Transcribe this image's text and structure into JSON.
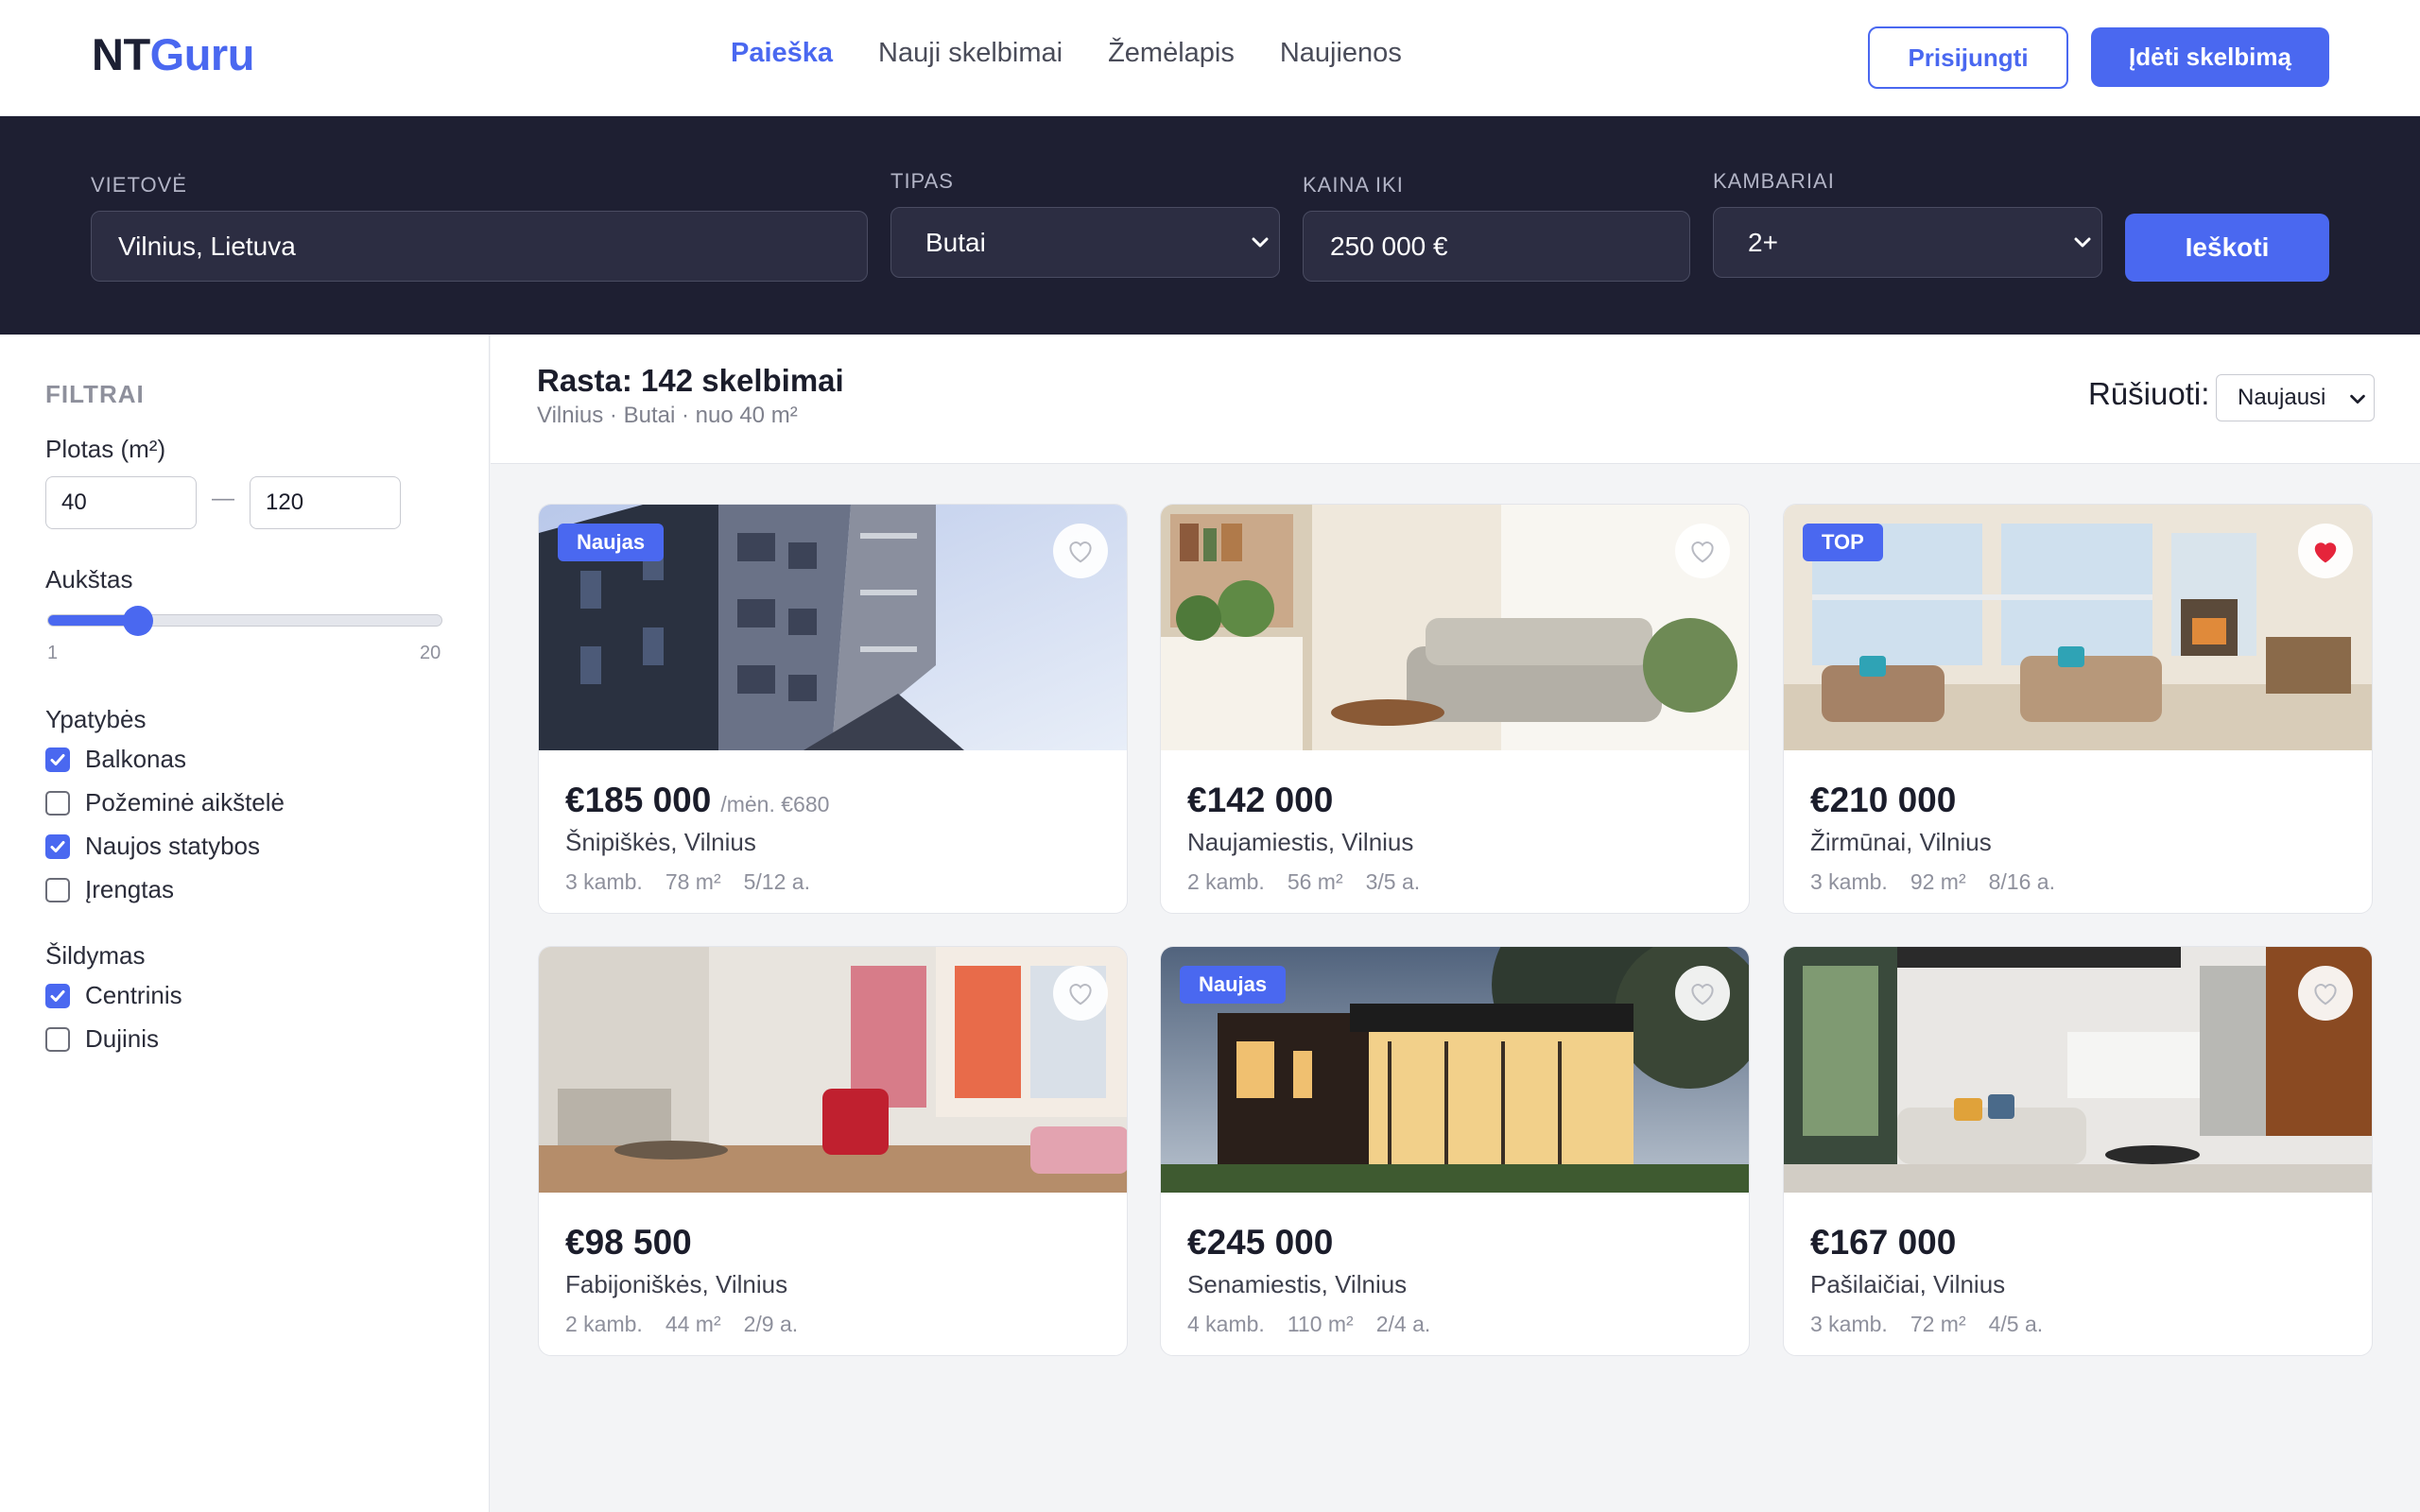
{
  "header": {
    "logo_a": "NT",
    "logo_b": "Guru",
    "nav": [
      "Paieška",
      "Nauji skelbimai",
      "Žemėlapis",
      "Naujienos"
    ],
    "login_label": "Prisijungti",
    "add_label": "Įdėti skelbimą"
  },
  "search": {
    "location_label": "VIETOVĖ",
    "location_value": "Vilnius, Lietuva",
    "type_label": "TIPAS",
    "type_value": "Butai",
    "price_label": "KAINA IKI",
    "price_value": "250 000 €",
    "rooms_label": "KAMBARIAI",
    "rooms_value": "2+",
    "search_label": "Ieškoti"
  },
  "filters": {
    "title": "FILTRAI",
    "area_label": "Plotas (m²)",
    "area_min": "40",
    "area_sep": "—",
    "area_max": "120",
    "floor_label": "Aukštas",
    "floor_min": "1",
    "floor_max": "20",
    "floor_value_fraction": 0.23,
    "features_label": "Ypatybės",
    "features": [
      {
        "label": "Balkonas",
        "checked": true
      },
      {
        "label": "Požeminė aikštelė",
        "checked": false
      },
      {
        "label": "Naujos statybos",
        "checked": true
      },
      {
        "label": "Įrengtas",
        "checked": false
      }
    ],
    "heating_label": "Šildymas",
    "heating": [
      {
        "label": "Centrinis",
        "checked": true
      },
      {
        "label": "Dujinis",
        "checked": false
      }
    ]
  },
  "results": {
    "title": "Rasta: 142 skelbimai",
    "subtitle": "Vilnius · Butai · nuo 40 m²",
    "sort_label": "Rūšiuoti:",
    "sort_value": "Naujausi"
  },
  "listings": [
    {
      "price": "€185 000",
      "extra": "/mėn. €680",
      "location": "Šnipiškės, Vilnius",
      "rooms": "3 kamb.",
      "area": "78 m²",
      "floor": "5/12 a.",
      "badge": "Naujas",
      "favorite": false
    },
    {
      "price": "€142 000",
      "extra": "",
      "location": "Naujamiestis, Vilnius",
      "rooms": "2 kamb.",
      "area": "56 m²",
      "floor": "3/5 a.",
      "badge": "",
      "favorite": false
    },
    {
      "price": "€210 000",
      "extra": "",
      "location": "Žirmūnai, Vilnius",
      "rooms": "3 kamb.",
      "area": "92 m²",
      "floor": "8/16 a.",
      "badge": "TOP",
      "favorite": true
    },
    {
      "price": "€98 500",
      "extra": "",
      "location": "Fabijoniškės, Vilnius",
      "rooms": "2 kamb.",
      "area": "44 m²",
      "floor": "2/9 a.",
      "badge": "",
      "favorite": false
    },
    {
      "price": "€245 000",
      "extra": "",
      "location": "Senamiestis, Vilnius",
      "rooms": "4 kamb.",
      "area": "110 m²",
      "floor": "2/4 a.",
      "badge": "Naujas",
      "favorite": false
    },
    {
      "price": "€167 000",
      "extra": "",
      "location": "Pašilaičiai, Vilnius",
      "rooms": "3 kamb.",
      "area": "72 m²",
      "floor": "4/5 a.",
      "badge": "",
      "favorite": false
    }
  ],
  "colors": {
    "accent": "#4a68f0",
    "dark_band": "#1e1f32",
    "favorite_active": "#e5243b"
  },
  "icons": {
    "favorite": "heart-icon",
    "dropdown": "chevron-down-icon",
    "checkbox": "check-icon"
  }
}
